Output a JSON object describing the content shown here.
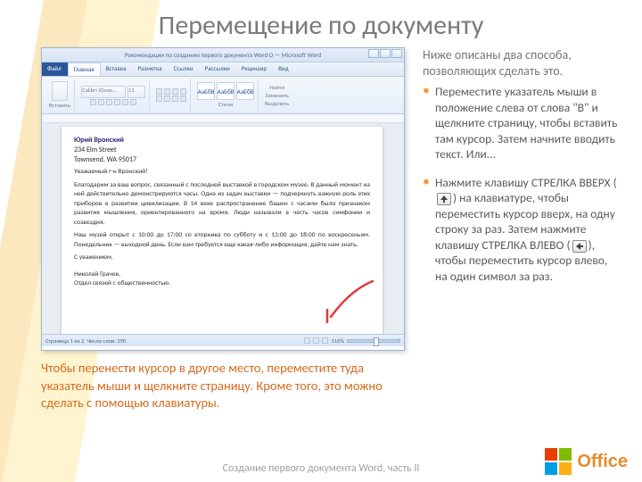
{
  "title": "Перемещение по документу",
  "word": {
    "title": "Рекомендации по созданию первого документа Word D — Microsoft Word",
    "tabs": {
      "file": "Файл",
      "home": "Главная",
      "insert": "Вставка",
      "layout": "Разметка",
      "refs": "Ссылки",
      "mail": "Рассылки",
      "review": "Рецензир",
      "view": "Вид"
    },
    "font_name": "Calibri (Осно...",
    "font_size": "11",
    "style_preview": "АаБбВ",
    "ribbon_labels": {
      "paste": "Вставить",
      "find": "Найти",
      "replace": "Заменить",
      "select": "Выделить"
    },
    "doc": {
      "name": "Юрий Вронский",
      "addr1": "234 Elm Street",
      "addr2": "Townsend, WA 95017",
      "greet": "Уважаемый г-н Вронский!",
      "p1": "Благодарим за ваш вопрос, связанный с последней выставкой в городском музее. В данный момент на ней действительно демонстрируются часы. Одна из задач выставки — подчеркнуть важную роль этих приборов в развитии цивилизации. В 14 веке распространение башен с часами было признаком развития мышления, ориентированного на время. Люди называли в честь часов симфонии и созвездия.",
      "p2": "Наш музей открыт с 10:00 до 17:00 со вторника по субботу и с 13:00 до 18:00 по воскресеньям. Понедельник — выходной день. Если вам требуется еще какая-либо информация, дайте нам знать.",
      "closing": "С уважением,",
      "sig1": "Николай Грачев,",
      "sig2": "Отдел связей с общественностью."
    },
    "status": {
      "page": "Страница 1 из 2",
      "words": "Число слов: 190",
      "zoom": "110%"
    }
  },
  "caption": "Чтобы перенести курсор в другое место, переместите туда указатель мыши и щелкните страницу. Кроме того, это можно сделать с помощью клавиатуры.",
  "intro": "Ниже описаны два способа, позволяющих сделать это.",
  "bullets": {
    "b1": "Переместите указатель мыши в положение слева от слова \"В\" и щелкните страницу, чтобы вставить там курсор. Затем начните вводить текст. Или...",
    "b2a": "Нажмите клавишу СТРЕЛКА ВВЕРХ (",
    "b2b": ") на клавиатуре, чтобы переместить курсор вверх, на одну строку за раз. Затем нажмите клавишу СТРЕЛКА ВЛЕВО (",
    "b2c": "), чтобы переместить курсор влево, на один символ за раз."
  },
  "footer": "Создание первого документа Word, часть II",
  "logo": "Office"
}
